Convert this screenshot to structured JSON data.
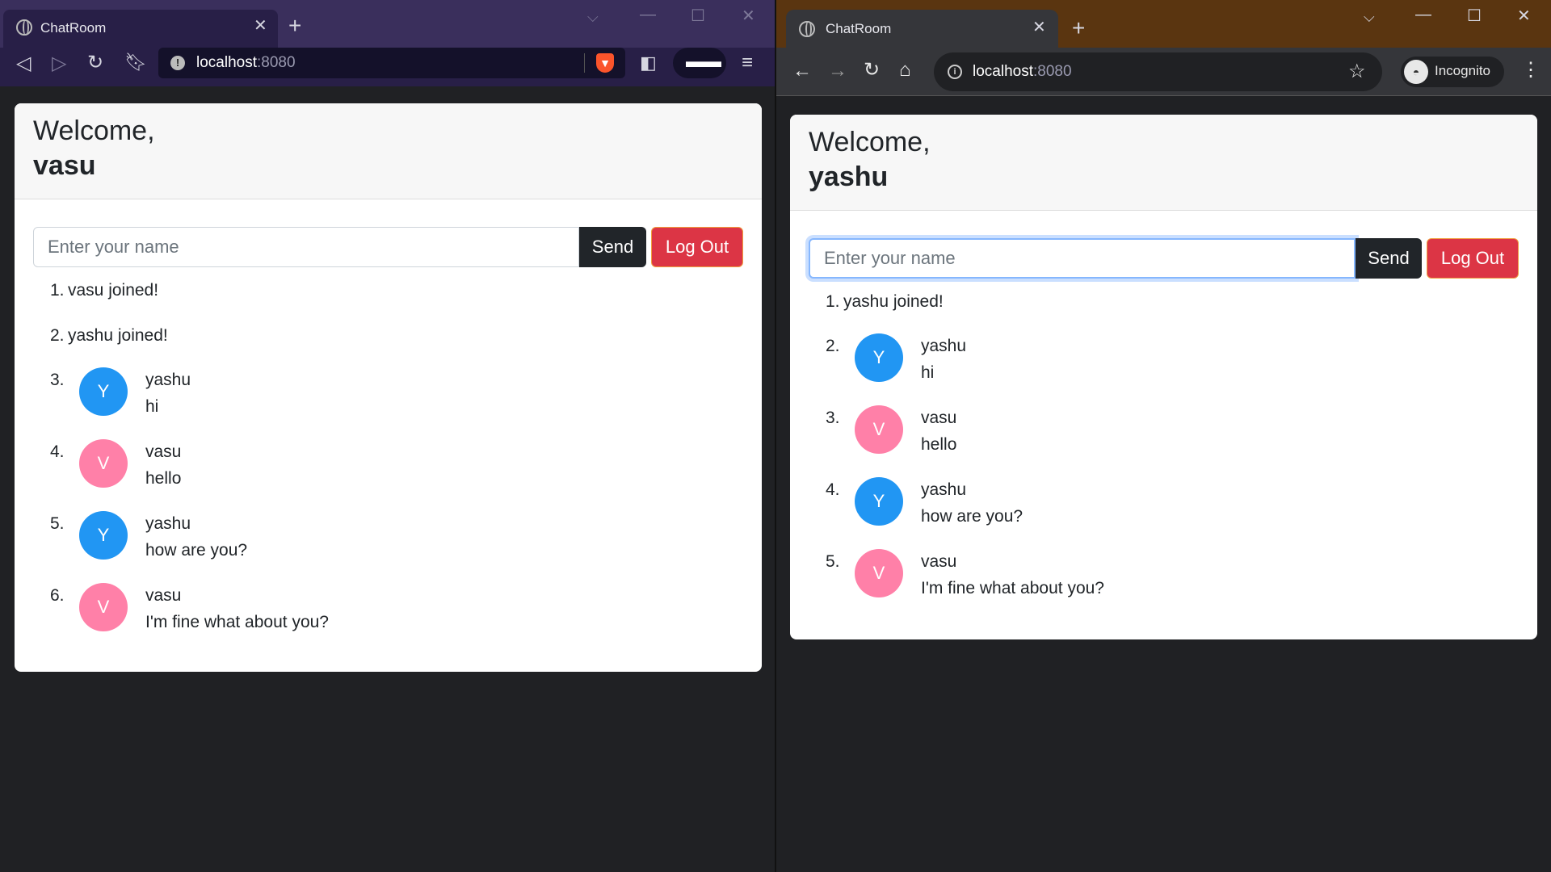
{
  "colors": {
    "brave_tabstrip": "#3a2f5c",
    "brave_toolbar": "#281f47",
    "chrome_tabstrip": "#5a3510",
    "chrome_toolbar": "#35363a",
    "page_background": "#202124",
    "avatar_y": "#2196f3",
    "avatar_v": "#ff80a8",
    "send_button": "#212529",
    "logout_button": "#dc3545"
  },
  "left_window": {
    "tab_title": "ChatRoom",
    "url_host": "localhost",
    "url_port": ":8080",
    "icons": [
      "back-icon",
      "forward-icon",
      "reload-icon",
      "bookmark-icon",
      "brave-shield-icon",
      "sidebar-icon",
      "private-sunglasses-icon",
      "menu-icon"
    ],
    "page": {
      "welcome": "Welcome,",
      "username": "vasu",
      "input_placeholder": "Enter your name",
      "send_label": "Send",
      "logout_label": "Log Out",
      "messages": [
        {
          "num": "1.",
          "text": "vasu joined!"
        },
        {
          "num": "2.",
          "text": "yashu joined!"
        },
        {
          "num": "3.",
          "initial": "Y",
          "name": "yashu",
          "body": "hi"
        },
        {
          "num": "4.",
          "initial": "V",
          "name": "vasu",
          "body": "hello"
        },
        {
          "num": "5.",
          "initial": "Y",
          "name": "yashu",
          "body": "how are you?"
        },
        {
          "num": "6.",
          "initial": "V",
          "name": "vasu",
          "body": "I'm fine what about you?"
        }
      ]
    }
  },
  "right_window": {
    "tab_title": "ChatRoom",
    "url_host": "localhost",
    "url_port": ":8080",
    "incognito_label": "Incognito",
    "icons": [
      "back-icon",
      "forward-icon",
      "reload-icon",
      "home-icon",
      "star-icon",
      "side-panel-icon",
      "incognito-icon",
      "kebab-menu-icon"
    ],
    "page": {
      "welcome": "Welcome,",
      "username": "yashu",
      "input_placeholder": "Enter your name",
      "send_label": "Send",
      "logout_label": "Log Out",
      "messages": [
        {
          "num": "1.",
          "text": "yashu joined!"
        },
        {
          "num": "2.",
          "initial": "Y",
          "name": "yashu",
          "body": "hi"
        },
        {
          "num": "3.",
          "initial": "V",
          "name": "vasu",
          "body": "hello"
        },
        {
          "num": "4.",
          "initial": "Y",
          "name": "yashu",
          "body": "how are you?"
        },
        {
          "num": "5.",
          "initial": "V",
          "name": "vasu",
          "body": "I'm fine what about you?"
        }
      ]
    }
  }
}
